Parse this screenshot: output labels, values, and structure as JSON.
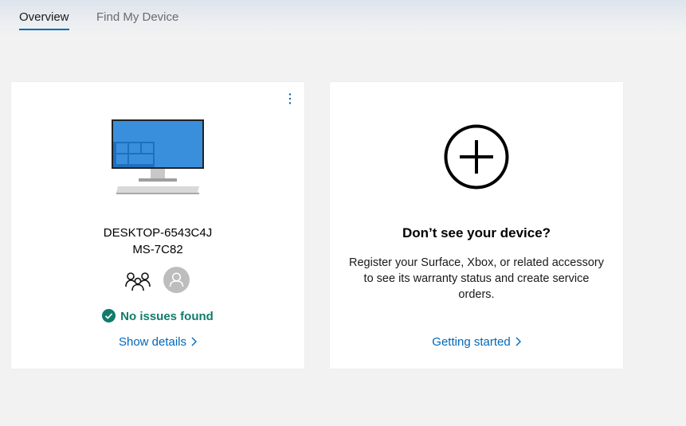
{
  "tabs": [
    {
      "label": "Overview",
      "active": true
    },
    {
      "label": "Find My Device",
      "active": false
    }
  ],
  "device_card": {
    "device_name": "DESKTOP-6543C4J",
    "device_model": "MS-7C82",
    "status_text": "No issues found",
    "status_color": "#107c6b",
    "details_link": "Show details",
    "icons": [
      "monitor-icon",
      "family-icon",
      "user-avatar-icon",
      "check-circle-icon",
      "more-vertical-icon",
      "chevron-right-icon"
    ]
  },
  "add_device_card": {
    "title": "Don’t see your device?",
    "description": "Register your Surface, Xbox, or related accessory to see its warranty status and create service orders.",
    "link": "Getting started",
    "icons": [
      "add-circle-icon",
      "chevron-right-icon"
    ]
  },
  "colors": {
    "accent": "#0067b8",
    "page_background": "#f2f2f2",
    "card_background": "#ffffff"
  }
}
